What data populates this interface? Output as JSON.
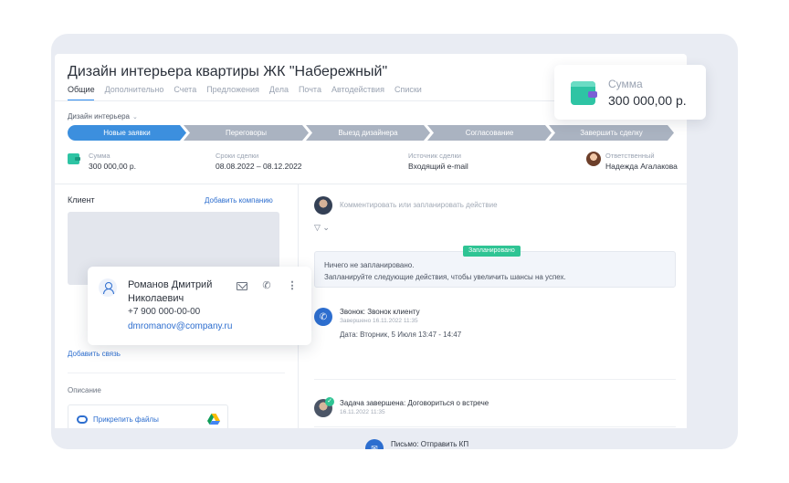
{
  "deal": {
    "title": "Дизайн интерьера квартиры ЖК \"Набережный\"",
    "tabs": [
      "Общие",
      "Дополнительно",
      "Счета",
      "Предложения",
      "Дела",
      "Почта",
      "Автодействия",
      "Списки"
    ],
    "pipeline": "Дизайн интерьера",
    "stages": [
      "Новые заявки",
      "Переговоры",
      "Выезд дизайнера",
      "Согласование",
      "Завершить сделку"
    ]
  },
  "summary": {
    "sum_label": "Сумма",
    "sum_value": "300 000,00 р.",
    "dates_label": "Сроки сделки",
    "dates_value": "08.08.2022  –  08.12.2022",
    "source_label": "Источник сделки",
    "source_value": "Входящий e-mail",
    "responsible_label": "Ответственный",
    "responsible_value": "Надежда Агалакова"
  },
  "left": {
    "client_label": "Клиент",
    "add_company": "Добавить компанию",
    "add_link": "Добавить связь",
    "description_label": "Описание",
    "attach_files": "Прикрепить файлы"
  },
  "right": {
    "comment_placeholder": "Комментировать или запланировать действие",
    "filter_icon": "▽ ⌄",
    "planned_badge": "Запланировано",
    "planned_line1": "Ничего не запланировано.",
    "planned_line2": "Запланируйте следующие действия, чтобы увеличить шансы на успех.",
    "activities": [
      {
        "title": "Звонок: Звонок клиенту",
        "sub": "Завершено 16.11.2022 11:35",
        "date": "Дата: Вторник, 5 Июля 13:47 - 14:47"
      },
      {
        "title": "Задача завершена: Договориться о встрече",
        "sub": "16.11.2022 11:35"
      },
      {
        "title": "Письмо: Отправить КП"
      }
    ]
  },
  "sum_card": {
    "label": "Сумма",
    "value": "300 000,00 р."
  },
  "contact": {
    "name": "Романов Дмитрий Николаевич",
    "phone": "+7 900 000-00-00",
    "email": "dmromanov@company.ru"
  },
  "colors": {
    "accent": "#2d6ecf",
    "stage_active": "#3c8fde",
    "stage_inactive": "#aab3c1",
    "success": "#2fc494",
    "wallet": "#2ec4a4",
    "backdrop": "#e9ecf3"
  }
}
